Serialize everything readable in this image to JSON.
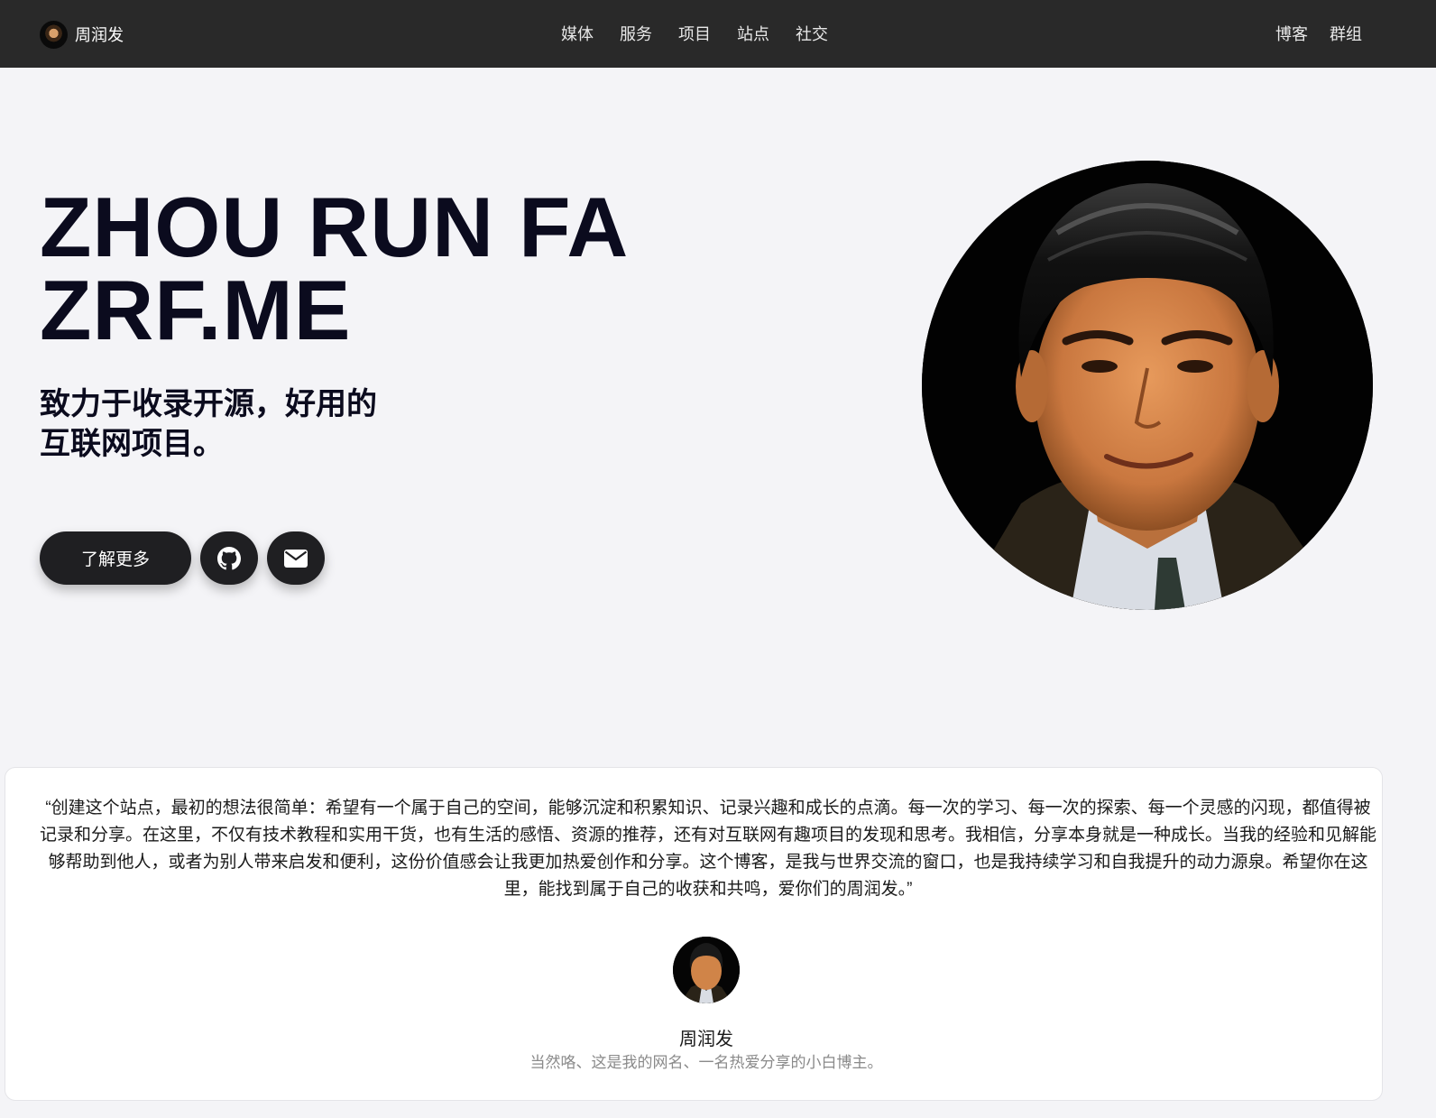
{
  "nav": {
    "brand_name": "周润发",
    "center_links": [
      "媒体",
      "服务",
      "项目",
      "站点",
      "社交"
    ],
    "right_links": [
      "博客",
      "群组"
    ]
  },
  "hero": {
    "title_line1": "ZHOU RUN FA",
    "title_line2": "ZRF.ME",
    "subtitle_line1": "致力于收录开源，好用的",
    "subtitle_line2": "互联网项目。",
    "more_button": "了解更多",
    "github_icon": "github-icon",
    "mail_icon": "envelope-icon"
  },
  "quote": {
    "text": "“创建这个站点，最初的想法很简单：希望有一个属于自己的空间，能够沉淀和积累知识、记录兴趣和成长的点滴。每一次的学习、每一次的探索、每一个灵感的闪现，都值得被记录和分享。在这里，不仅有技术教程和实用干货，也有生活的感悟、资源的推荐，还有对互联网有趣项目的发现和思考。我相信，分享本身就是一种成长。当我的经验和见解能够帮助到他人，或者为别人带来启发和便利，这份价值感会让我更加热爱创作和分享。这个博客，是我与世界交流的窗口，也是我持续学习和自我提升的动力源泉。希望你在这里，能找到属于自己的收获和共鸣，爱你们的周润发。”",
    "author_name": "周润发",
    "author_desc": "当然咯、这是我的网名、一名热爱分享的小白博主。"
  },
  "colors": {
    "navbar_bg": "#292929",
    "page_bg": "#f4f4f7",
    "title_color": "#0b0b1e",
    "button_bg": "#1f1f22"
  }
}
